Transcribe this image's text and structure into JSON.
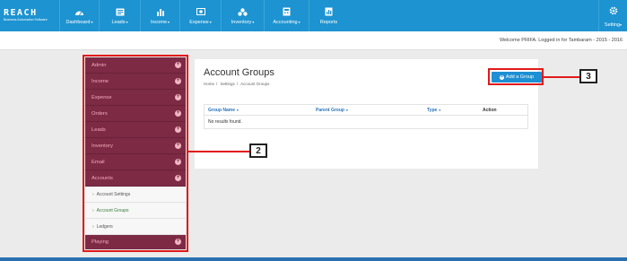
{
  "logo": {
    "word": "REACH",
    "tagline": "Business Automation Software"
  },
  "nav": [
    {
      "label": "Dashboard",
      "icon": "dashboard-icon"
    },
    {
      "label": "Leads",
      "icon": "leads-icon"
    },
    {
      "label": "Income",
      "icon": "income-icon"
    },
    {
      "label": "Expense",
      "icon": "expense-icon"
    },
    {
      "label": "Inventory",
      "icon": "inventory-icon"
    },
    {
      "label": "Accounting",
      "icon": "accounting-icon"
    },
    {
      "label": "Reports",
      "icon": "reports-icon"
    }
  ],
  "settings_label": "Setting",
  "welcome": "Welcome PRIFA. Logged in for Tambaram - 2015 - 2016",
  "sidebar": {
    "items": [
      "Admin",
      "Income",
      "Expense",
      "Orders",
      "Leads",
      "Inventory",
      "Email",
      "Accounts"
    ],
    "sub_items": [
      "Account Settings",
      "Account Groups",
      "Ledgers"
    ],
    "active_sub": "Account Groups",
    "last_item": "Playing"
  },
  "page": {
    "title": "Account Groups",
    "breadcrumb": [
      "Home",
      "Settings",
      "Account Groups"
    ],
    "add_button": "Add a Group"
  },
  "table": {
    "headers": [
      "Group Name",
      "Parent Group",
      "Type",
      "Action"
    ],
    "empty_text": "No results found."
  },
  "callouts": [
    "2",
    "3"
  ],
  "colors": {
    "accent": "#1d93d1",
    "sidebar": "#7d2a45",
    "annotation": "#e11a1a"
  }
}
